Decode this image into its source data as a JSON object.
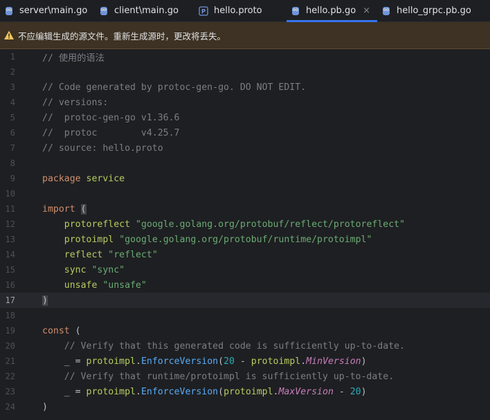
{
  "tabs": [
    {
      "label": "server\\main.go",
      "icon": "gopher-icon",
      "active": false
    },
    {
      "label": "client\\main.go",
      "icon": "gopher-icon",
      "active": false
    },
    {
      "label": "hello.proto",
      "icon": "proto-file-icon",
      "active": false
    },
    {
      "label": "hello.pb.go",
      "icon": "gopher-icon",
      "active": true,
      "close": "×"
    },
    {
      "label": "hello_grpc.pb.go",
      "icon": "gopher-icon",
      "active": false
    }
  ],
  "banner": {
    "icon": "warning-icon",
    "text": "不应编辑生成的源文件。重新生成源时，更改将丢失。"
  },
  "editor": {
    "current_line": 17,
    "lines": [
      {
        "n": "1",
        "tokens": [
          {
            "t": "// 使用的语法",
            "c": "comment"
          }
        ]
      },
      {
        "n": "2",
        "tokens": []
      },
      {
        "n": "3",
        "tokens": [
          {
            "t": "// Code generated by protoc-gen-go. DO NOT EDIT.",
            "c": "comment"
          }
        ]
      },
      {
        "n": "4",
        "tokens": [
          {
            "t": "// versions:",
            "c": "comment"
          }
        ]
      },
      {
        "n": "5",
        "tokens": [
          {
            "t": "//  protoc-gen-go v1.36.6",
            "c": "comment"
          }
        ]
      },
      {
        "n": "6",
        "tokens": [
          {
            "t": "//  protoc        v4.25.7",
            "c": "comment"
          }
        ]
      },
      {
        "n": "7",
        "tokens": [
          {
            "t": "// source: hello.proto",
            "c": "comment"
          }
        ]
      },
      {
        "n": "8",
        "tokens": []
      },
      {
        "n": "9",
        "tokens": [
          {
            "t": "package",
            "c": "kw"
          },
          {
            "t": " ",
            "c": "plain"
          },
          {
            "t": "service",
            "c": "pkg"
          }
        ]
      },
      {
        "n": "10",
        "tokens": []
      },
      {
        "n": "11",
        "tokens": [
          {
            "t": "import",
            "c": "kw"
          },
          {
            "t": " ",
            "c": "plain"
          },
          {
            "t": "(",
            "c": "paren-hl"
          }
        ]
      },
      {
        "n": "12",
        "tokens": [
          {
            "t": "    ",
            "c": "plain"
          },
          {
            "t": "protoreflect",
            "c": "alias"
          },
          {
            "t": " ",
            "c": "plain"
          },
          {
            "t": "\"google.golang.org/protobuf/reflect/protoreflect\"",
            "c": "str"
          }
        ]
      },
      {
        "n": "13",
        "tokens": [
          {
            "t": "    ",
            "c": "plain"
          },
          {
            "t": "protoimpl",
            "c": "alias"
          },
          {
            "t": " ",
            "c": "plain"
          },
          {
            "t": "\"google.golang.org/protobuf/runtime/protoimpl\"",
            "c": "str"
          }
        ]
      },
      {
        "n": "14",
        "tokens": [
          {
            "t": "    ",
            "c": "plain"
          },
          {
            "t": "reflect",
            "c": "alias"
          },
          {
            "t": " ",
            "c": "plain"
          },
          {
            "t": "\"reflect\"",
            "c": "str"
          }
        ]
      },
      {
        "n": "15",
        "tokens": [
          {
            "t": "    ",
            "c": "plain"
          },
          {
            "t": "sync",
            "c": "alias"
          },
          {
            "t": " ",
            "c": "plain"
          },
          {
            "t": "\"sync\"",
            "c": "str"
          }
        ]
      },
      {
        "n": "16",
        "tokens": [
          {
            "t": "    ",
            "c": "plain"
          },
          {
            "t": "unsafe",
            "c": "alias"
          },
          {
            "t": " ",
            "c": "plain"
          },
          {
            "t": "\"unsafe\"",
            "c": "str"
          }
        ]
      },
      {
        "n": "17",
        "tokens": [
          {
            "t": ")",
            "c": "paren-hl"
          }
        ]
      },
      {
        "n": "18",
        "tokens": []
      },
      {
        "n": "19",
        "tokens": [
          {
            "t": "const",
            "c": "kw"
          },
          {
            "t": " (",
            "c": "plain"
          }
        ]
      },
      {
        "n": "20",
        "tokens": [
          {
            "t": "    // Verify that this generated code is sufficiently up-to-date.",
            "c": "comment"
          }
        ]
      },
      {
        "n": "21",
        "tokens": [
          {
            "t": "    _ = ",
            "c": "plain"
          },
          {
            "t": "protoimpl",
            "c": "alias"
          },
          {
            "t": ".",
            "c": "plain"
          },
          {
            "t": "EnforceVersion",
            "c": "func"
          },
          {
            "t": "(",
            "c": "plain"
          },
          {
            "t": "20",
            "c": "num"
          },
          {
            "t": " - ",
            "c": "plain"
          },
          {
            "t": "protoimpl",
            "c": "alias"
          },
          {
            "t": ".",
            "c": "plain"
          },
          {
            "t": "MinVersion",
            "c": "const"
          },
          {
            "t": ")",
            "c": "plain"
          }
        ]
      },
      {
        "n": "22",
        "tokens": [
          {
            "t": "    // Verify that runtime/protoimpl is sufficiently up-to-date.",
            "c": "comment"
          }
        ]
      },
      {
        "n": "23",
        "tokens": [
          {
            "t": "    _ = ",
            "c": "plain"
          },
          {
            "t": "protoimpl",
            "c": "alias"
          },
          {
            "t": ".",
            "c": "plain"
          },
          {
            "t": "EnforceVersion",
            "c": "func"
          },
          {
            "t": "(",
            "c": "plain"
          },
          {
            "t": "protoimpl",
            "c": "alias"
          },
          {
            "t": ".",
            "c": "plain"
          },
          {
            "t": "MaxVersion",
            "c": "const"
          },
          {
            "t": " - ",
            "c": "plain"
          },
          {
            "t": "20",
            "c": "num"
          },
          {
            "t": ")",
            "c": "plain"
          }
        ]
      },
      {
        "n": "24",
        "tokens": [
          {
            "t": ")",
            "c": "plain"
          }
        ]
      }
    ]
  },
  "colors": {
    "accent": "#3574f0",
    "banner_bg": "#3d3223",
    "warning": "#f2c55c"
  }
}
